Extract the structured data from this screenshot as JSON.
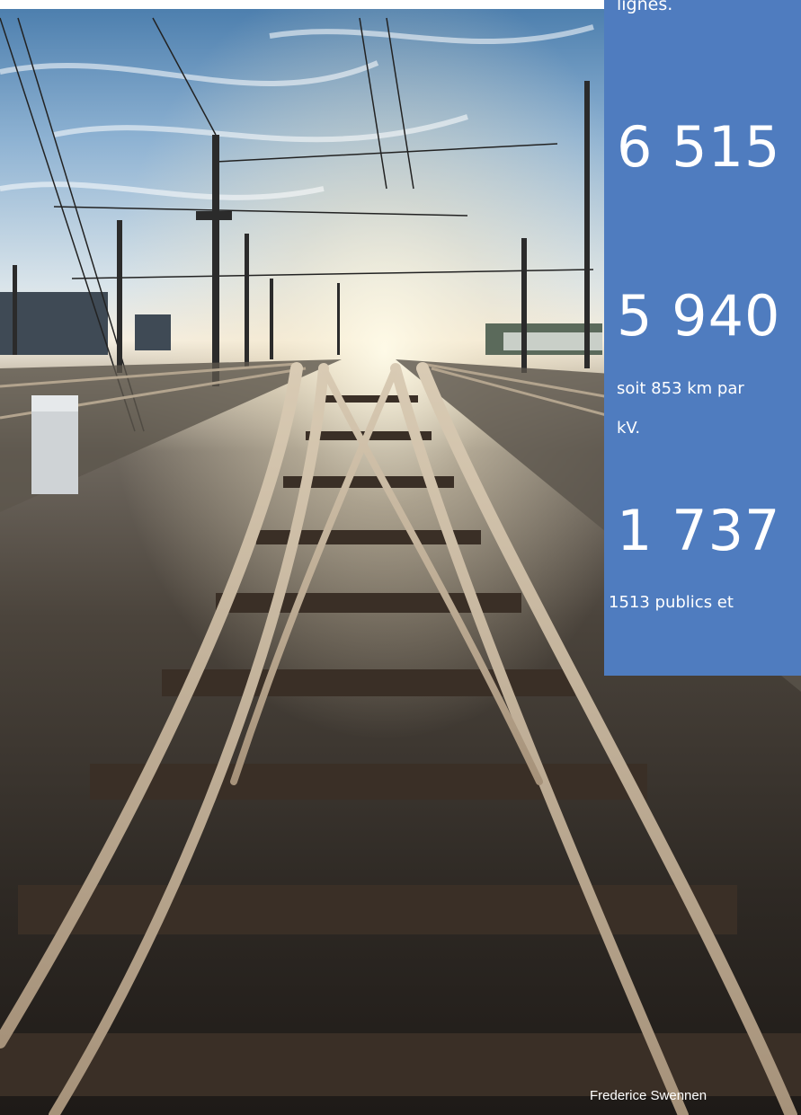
{
  "panel": {
    "top_fragment": "lignes.",
    "stat1": {
      "value": "6 515"
    },
    "stat2": {
      "value": "5 940",
      "caption_line1": "soit 853 km par",
      "caption_line2": "kV."
    },
    "stat3": {
      "value": "1 737",
      "caption": "1513 publics et"
    },
    "color": "#4f7cbf"
  },
  "photo": {
    "credit": "Frederice Swennen"
  }
}
